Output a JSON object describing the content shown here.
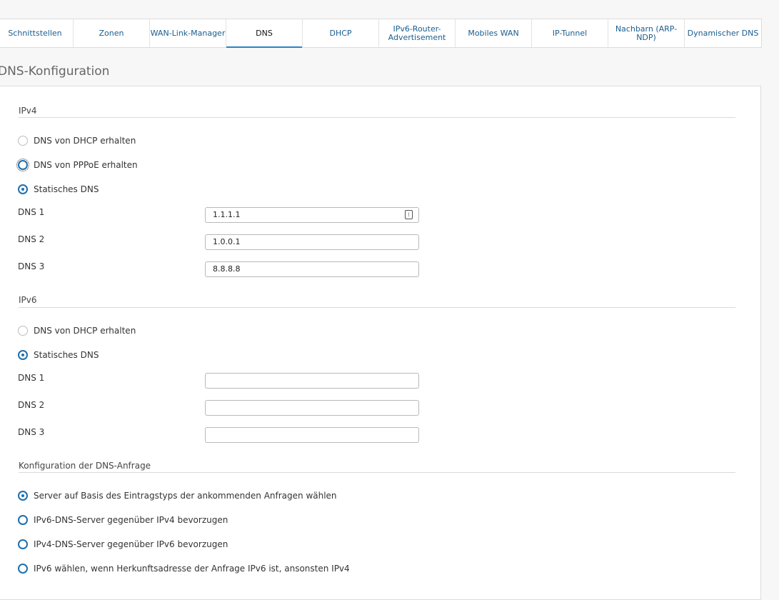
{
  "tabs": [
    {
      "label": "Schnittstellen",
      "active": false
    },
    {
      "label": "Zonen",
      "active": false
    },
    {
      "label": "WAN-Link-Manager",
      "active": false
    },
    {
      "label": "DNS",
      "active": true
    },
    {
      "label": "DHCP",
      "active": false
    },
    {
      "label": "IPv6-Router-Advertisement",
      "active": false
    },
    {
      "label": "Mobiles WAN",
      "active": false
    },
    {
      "label": "IP-Tunnel",
      "active": false
    },
    {
      "label": "Nachbarn (ARP-NDP)",
      "active": false
    },
    {
      "label": "Dynamischer DNS",
      "active": false
    }
  ],
  "page_title": "DNS-Konfiguration",
  "ipv4": {
    "title": "IPv4",
    "options": [
      {
        "label": "DNS von DHCP erhalten",
        "selected": false
      },
      {
        "label": "DNS von PPPoE erhalten",
        "selected": false
      },
      {
        "label": "Statisches DNS",
        "selected": true
      }
    ],
    "dns1_label": "DNS 1",
    "dns1_value": "1.1.1.1",
    "dns2_label": "DNS 2",
    "dns2_value": "1.0.0.1",
    "dns3_label": "DNS 3",
    "dns3_value": "8.8.8.8"
  },
  "ipv6": {
    "title": "IPv6",
    "options": [
      {
        "label": "DNS von DHCP erhalten",
        "selected": false
      },
      {
        "label": "Statisches DNS",
        "selected": true
      }
    ],
    "dns1_label": "DNS 1",
    "dns1_value": "",
    "dns2_label": "DNS 2",
    "dns2_value": "",
    "dns3_label": "DNS 3",
    "dns3_value": ""
  },
  "query": {
    "title": "Konfiguration der DNS-Anfrage",
    "options": [
      {
        "label": "Server auf Basis des Eintragstyps der ankommenden Anfragen wählen",
        "selected": true
      },
      {
        "label": "IPv6-DNS-Server gegenüber IPv4 bevorzugen",
        "selected": false
      },
      {
        "label": "IPv4-DNS-Server gegenüber IPv6 bevorzugen",
        "selected": false
      },
      {
        "label": "IPv6 wählen, wenn Herkunftsadresse der Anfrage IPv6 ist, ansonsten IPv4",
        "selected": false
      }
    ]
  },
  "colors": {
    "accent": "#2a84c6",
    "link": "#1a5d8f",
    "radio_selected": "#1e6fad"
  },
  "icons": {
    "dns1_field_icon": "password-manager-icon"
  }
}
